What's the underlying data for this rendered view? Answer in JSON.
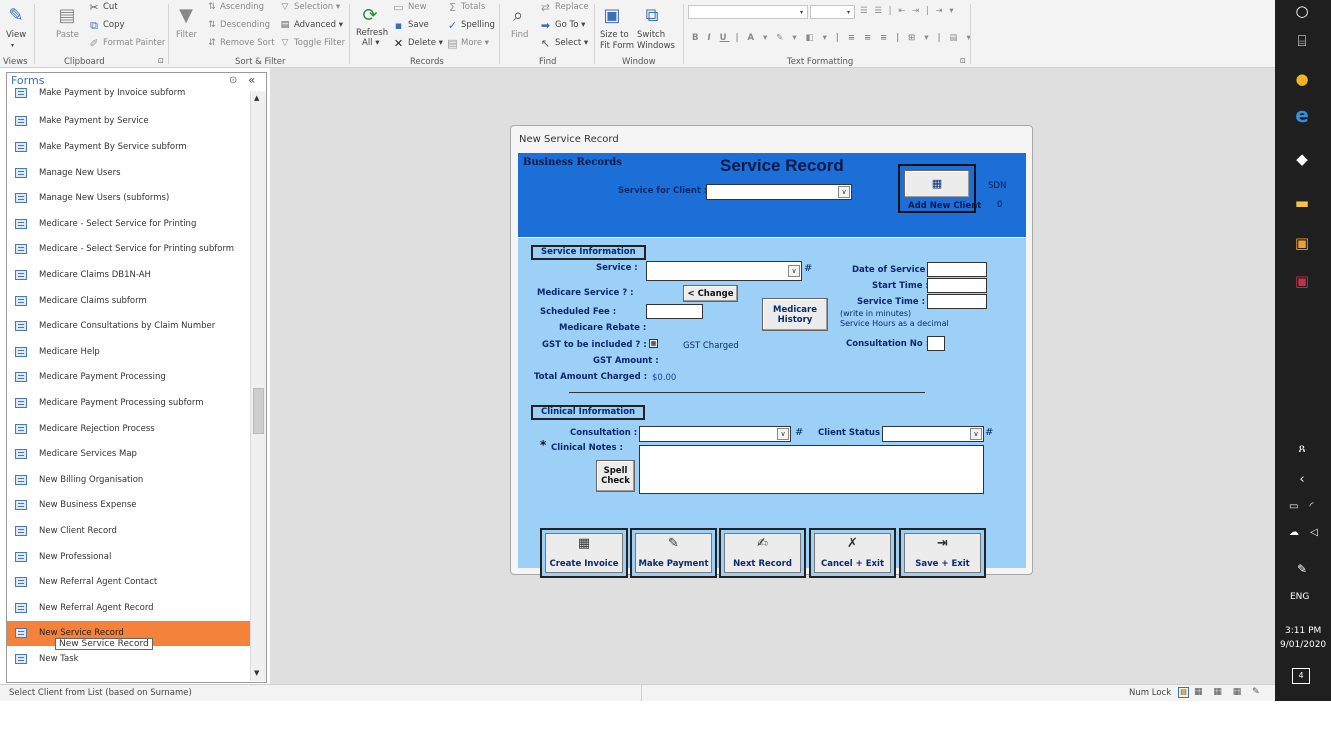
{
  "ribbon": {
    "view": "View",
    "paste": "Paste",
    "cut": "Cut",
    "copy": "Copy",
    "format_painter": "Format Painter",
    "filter": "Filter",
    "ascending": "Ascending",
    "descending": "Descending",
    "remove_sort": "Remove Sort",
    "selection": "Selection",
    "advanced": "Advanced",
    "toggle_filter": "Toggle Filter",
    "refresh": "Refresh",
    "refresh_all": "All",
    "new": "New",
    "save": "Save",
    "delete": "Delete",
    "totals": "Totals",
    "spelling": "Spelling",
    "more": "More",
    "find": "Find",
    "replace": "Replace",
    "goto": "Go To",
    "select": "Select",
    "size_to": "Size to",
    "fit_form": "Fit Form",
    "switch": "Switch",
    "windows": "Windows",
    "group_views": "Views",
    "group_clipboard": "Clipboard",
    "group_sortfilter": "Sort & Filter",
    "group_records": "Records",
    "group_find": "Find",
    "group_window": "Window",
    "group_textformatting": "Text Formatting"
  },
  "nav": {
    "title": "Forms",
    "items": [
      "Make Payment by Invoice subform",
      "Make Payment by Service",
      "Make Payment By Service subform",
      "Manage New Users",
      "Manage New Users (subforms)",
      "Medicare - Select Service for Printing",
      "Medicare - Select Service for Printing subform",
      "Medicare Claims DB1N-AH",
      "Medicare Claims subform",
      "Medicare Consultations by Claim Number",
      "Medicare Help",
      "Medicare Payment Processing",
      "Medicare Payment Processing subform",
      "Medicare Rejection Process",
      "Medicare Services Map",
      "New Billing Organisation",
      "New Business Expense",
      "New Client Record",
      "New Professional",
      "New Referral Agent Contact",
      "New Referral Agent Record",
      "New Service Record",
      "New Task"
    ],
    "selected_index": 21,
    "tooltip": "New Service Record"
  },
  "form": {
    "window_title": "New Service Record",
    "business_records": "Business Records",
    "title": "Service Record",
    "service_for_client": "Service for Client :",
    "add_new_client": "Add New Client",
    "sdn_label": "SDN",
    "sdn_value": "0",
    "section_service": "Service Information",
    "service": "Service :",
    "hash": "#",
    "medicare_service": "Medicare Service ? :",
    "change": "< Change",
    "scheduled_fee": "Scheduled Fee :",
    "medicare_rebate": "Medicare Rebate :",
    "gst_included": "GST to be included ? :",
    "gst_charged": "GST Charged",
    "gst_amount": "GST Amount :",
    "total_charged": "Total Amount Charged :",
    "total_value": "$0.00",
    "medicare_history_1": "Medicare",
    "medicare_history_2": "History",
    "date_of_service": "Date of Service :",
    "start_time": "Start Time :",
    "service_time": "Service Time :",
    "write_minutes": "(write in minutes)",
    "hours_decimal": "Service Hours as a decimal",
    "consultation_no": "Consultation No :",
    "section_clinical": "Clinical Information",
    "consultation": "Consultation :",
    "client_status": "Client Status :",
    "asterisk": "*",
    "clinical_notes": "Clinical Notes :",
    "spell": "Spell",
    "check": "Check",
    "buttons": [
      "Create Invoice",
      "Make Payment",
      "Next Record",
      "Cancel + Exit",
      "Save + Exit"
    ]
  },
  "status": {
    "text": "Select Client from List (based on Surname)",
    "numlock": "Num Lock"
  },
  "taskbar": {
    "eng": "ENG",
    "time": "3:11 PM",
    "date": "9/01/2020",
    "notif_count": "4"
  },
  "colors": {
    "form_header": "#1b6fd6",
    "form_body": "#9dd0f6",
    "selected_nav": "#f4823a",
    "title_blue": "#3c6fb8"
  }
}
